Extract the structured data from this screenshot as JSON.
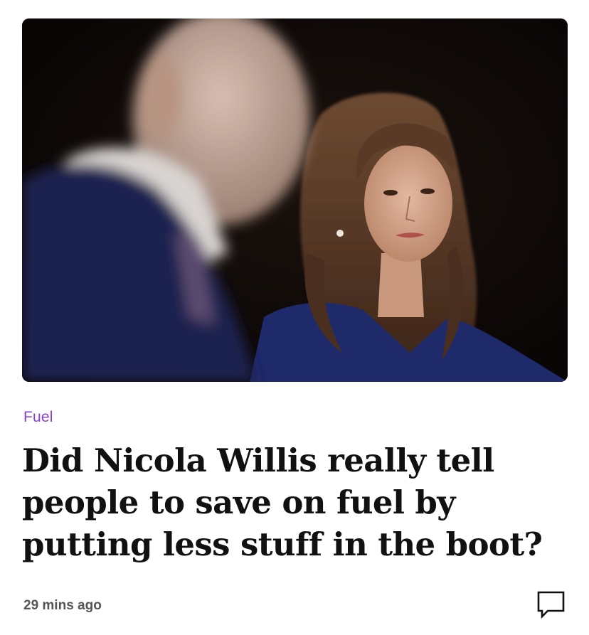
{
  "article": {
    "image": {
      "subject": "press-photo"
    },
    "category": "Fuel",
    "headline": "Did Nicola Willis really tell people to save on fuel by putting less stuff in the boot?",
    "published_ago": "29 mins ago",
    "comment_icon": "speech-bubble-icon"
  },
  "colors": {
    "category": "#8a3fd1",
    "headline": "#111111",
    "timestamp": "#555555",
    "image_background": "#0a0706"
  }
}
